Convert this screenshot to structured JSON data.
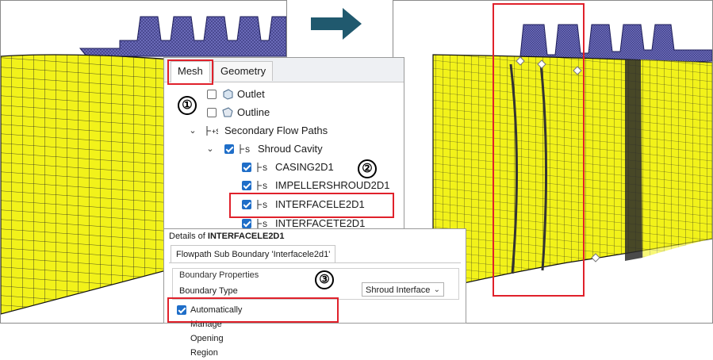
{
  "tree": {
    "tabs": [
      {
        "label": "Mesh"
      },
      {
        "label": "Geometry"
      }
    ],
    "items": [
      {
        "label": "Outlet",
        "checked": false,
        "icon": "outlet-icon"
      },
      {
        "label": "Outline",
        "checked": false,
        "icon": "outline-icon"
      },
      {
        "label": "Secondary Flow Paths",
        "icon": "flow-path-icon",
        "expanded": true
      },
      {
        "label": "Shroud Cavity",
        "checked": true,
        "icon": "flow-path-icon",
        "expanded": true
      },
      {
        "label": "CASING2D1",
        "checked": true,
        "icon": "flow-path-icon"
      },
      {
        "label": "IMPELLERSHROUD2D1",
        "checked": true,
        "icon": "flow-path-icon"
      },
      {
        "label": "INTERFACELE2D1",
        "checked": true,
        "icon": "flow-path-icon"
      },
      {
        "label": "INTERFACETE2D1",
        "checked": true,
        "icon": "flow-path-icon"
      }
    ]
  },
  "details": {
    "header_prefix": "Details of",
    "header_name": "INTERFACELE2D1",
    "tab_label": "Flowpath Sub Boundary 'Interfacele2d1'",
    "group_title": "Boundary Properties",
    "boundary_type_label": "Boundary Type",
    "boundary_type_value": "Shroud Interface",
    "auto_manage_label": "Automatically Manage Opening Region",
    "auto_manage_checked": true
  },
  "callouts": [
    "①",
    "②",
    "③"
  ],
  "colors": {
    "mesh_yellow": "#f2f21a",
    "mesh_blue": "#5a5aa8",
    "highlight_red": "#e0212b",
    "arrow_teal": "#20596e",
    "check_blue": "#1f6ec8"
  }
}
